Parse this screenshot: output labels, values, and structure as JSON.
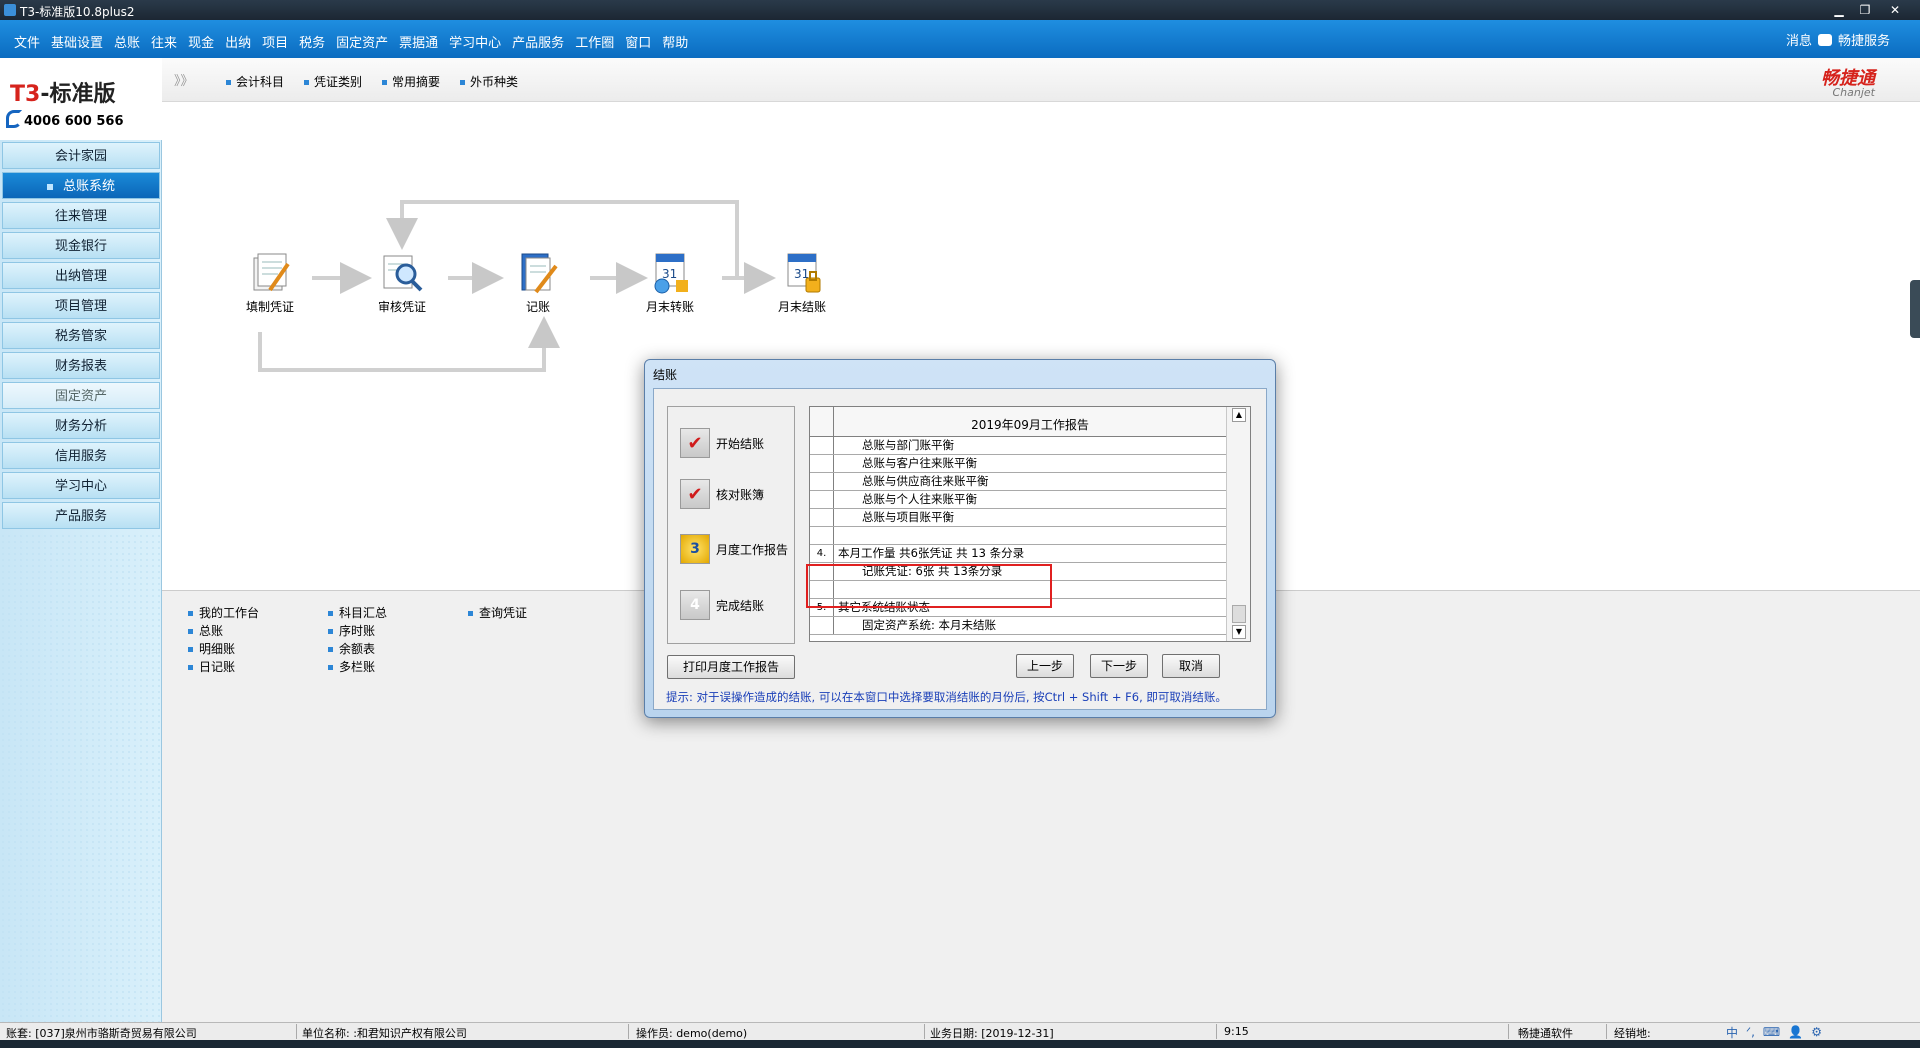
{
  "window": {
    "title": "T3-标准版10.8plus2",
    "min_icon": "minimize-icon",
    "max_icon": "maximize-icon",
    "close_icon": "close-icon"
  },
  "menubar": {
    "items": [
      "文件",
      "基础设置",
      "总账",
      "往来",
      "现金",
      "出纳",
      "项目",
      "税务",
      "固定资产",
      "票据通",
      "学习中心",
      "产品服务",
      "工作圈",
      "窗口",
      "帮助"
    ],
    "messages": "消息",
    "service": "畅捷服务"
  },
  "logo": {
    "brand_prefix": "T3",
    "brand_suffix": "-标准版",
    "phone": "4006 600 566"
  },
  "sidebar": {
    "items": [
      {
        "label": "会计家园",
        "state": "normal"
      },
      {
        "label": "总账系统",
        "state": "active"
      },
      {
        "label": "往来管理",
        "state": "normal"
      },
      {
        "label": "现金银行",
        "state": "normal"
      },
      {
        "label": "出纳管理",
        "state": "normal"
      },
      {
        "label": "项目管理",
        "state": "normal"
      },
      {
        "label": "税务管家",
        "state": "normal"
      },
      {
        "label": "财务报表",
        "state": "normal"
      },
      {
        "label": "固定资产",
        "state": "dim"
      },
      {
        "label": "财务分析",
        "state": "normal"
      },
      {
        "label": "信用服务",
        "state": "normal"
      },
      {
        "label": "学习中心",
        "state": "normal"
      },
      {
        "label": "产品服务",
        "state": "normal"
      }
    ]
  },
  "toolbar": {
    "expand": "》》",
    "items": [
      "会计科目",
      "凭证类别",
      "常用摘要",
      "外币种类"
    ],
    "brand_cn": "畅捷通",
    "brand_en": "Chanjet"
  },
  "flow": {
    "nodes": [
      {
        "label": "填制凭证",
        "icon": "voucher-fill-icon"
      },
      {
        "label": "审核凭证",
        "icon": "voucher-audit-icon"
      },
      {
        "label": "记账",
        "icon": "posting-icon"
      },
      {
        "label": "月末转账",
        "icon": "month-end-transfer-icon"
      },
      {
        "label": "月末结账",
        "icon": "month-end-close-icon"
      }
    ]
  },
  "quick_links": {
    "col1": [
      "我的工作台",
      "总账",
      "明细账",
      "日记账"
    ],
    "col2": [
      "科目汇总",
      "序时账",
      "余额表",
      "多栏账"
    ],
    "col3": [
      "查询凭证"
    ]
  },
  "dialog": {
    "title": "结账",
    "steps": [
      {
        "label": "开始结账",
        "mark": "✔",
        "status": "done"
      },
      {
        "label": "核对账簿",
        "mark": "✔",
        "status": "done"
      },
      {
        "label": "月度工作报告",
        "mark": "3",
        "status": "current"
      },
      {
        "label": "完成结账",
        "mark": "4",
        "status": "pending"
      }
    ],
    "report_header": "2019年09月工作报告",
    "report_rows": [
      {
        "idx": "",
        "text": "总账与部门账平衡",
        "indent": true
      },
      {
        "idx": "",
        "text": "总账与客户往来账平衡",
        "indent": true
      },
      {
        "idx": "",
        "text": "总账与供应商往来账平衡",
        "indent": true
      },
      {
        "idx": "",
        "text": "总账与个人往来账平衡",
        "indent": true
      },
      {
        "idx": "",
        "text": "总账与项目账平衡",
        "indent": true
      },
      {
        "idx": "",
        "text": "",
        "indent": false
      },
      {
        "idx": "4.",
        "text": "本月工作量  共6张凭证  共 13 条分录",
        "indent": false
      },
      {
        "idx": "",
        "text": "记账凭证: 6张   共   13条分录",
        "indent": true
      },
      {
        "idx": "",
        "text": "",
        "indent": false
      },
      {
        "idx": "5.",
        "text": "其它系统结账状态",
        "indent": false
      },
      {
        "idx": "",
        "text": "固定资产系统: 本月未结账",
        "indent": true
      }
    ],
    "buttons": {
      "print": "打印月度工作报告",
      "prev": "上一步",
      "next": "下一步",
      "cancel": "取消"
    },
    "hint": "提示: 对于误操作造成的结账, 可以在本窗口中选择要取消结账的月份后, 按Ctrl + Shift + F6, 即可取消结账。"
  },
  "statusbar": {
    "account": "账套: [037]泉州市骆斯奇贸易有限公司",
    "unit": "单位名称: :和君知识产权有限公司",
    "operator": "操作员: demo(demo)",
    "business_date": "业务日期: [2019-12-31]",
    "time": "9:15",
    "vendor": "畅捷通软件",
    "manager": "经销地:",
    "ime": [
      "中",
      "ᐟ,",
      "⌨",
      "👤",
      "⚙"
    ]
  },
  "colors": {
    "menu_blue": "#0b6cc0",
    "brand_red": "#d6231c",
    "highlight_red": "#e02020",
    "hint_blue": "#1a3fb8"
  }
}
